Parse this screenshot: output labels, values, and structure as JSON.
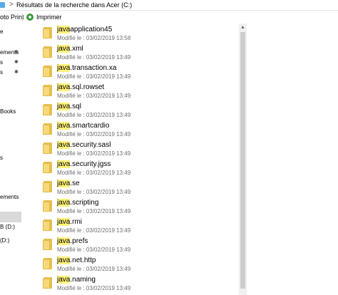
{
  "address": {
    "separator": ">",
    "path": "Résultats de la recherche dans Acer (C:)"
  },
  "toolbar": {
    "left_text": "oto Print",
    "print_label": "Imprimer"
  },
  "nav": {
    "items": [
      {
        "label": "e",
        "pinned": false
      },
      {
        "label": "ements",
        "pinned": true
      },
      {
        "label": "s",
        "pinned": true
      },
      {
        "label": "s",
        "pinned": true
      },
      {
        "label": "Books",
        "pinned": false
      },
      {
        "label": "s",
        "pinned": false
      },
      {
        "label": "ements",
        "pinned": false
      },
      {
        "label": "B (D:)",
        "pinned": false
      },
      {
        "label": "(D:)",
        "pinned": false
      }
    ]
  },
  "results": {
    "modified_label": "Modifié le :",
    "items": [
      {
        "highlight": "java",
        "rest": "application45",
        "date": "03/02/2019 13:58"
      },
      {
        "highlight": "java",
        "rest": ".xml",
        "date": "03/02/2019 13:49"
      },
      {
        "highlight": "java",
        "rest": ".transaction.xa",
        "date": "03/02/2019 13:49"
      },
      {
        "highlight": "java",
        "rest": ".sql.rowset",
        "date": "03/02/2019 13:49"
      },
      {
        "highlight": "java",
        "rest": ".sql",
        "date": "03/02/2019 13:49"
      },
      {
        "highlight": "java",
        "rest": ".smartcardio",
        "date": "03/02/2019 13:49"
      },
      {
        "highlight": "java",
        "rest": ".security.sasl",
        "date": "03/02/2019 13:49"
      },
      {
        "highlight": "java",
        "rest": ".security.jgss",
        "date": "03/02/2019 13:49"
      },
      {
        "highlight": "java",
        "rest": ".se",
        "date": "03/02/2019 13:49"
      },
      {
        "highlight": "java",
        "rest": ".scripting",
        "date": "03/02/2019 13:49"
      },
      {
        "highlight": "java",
        "rest": ".rmi",
        "date": "03/02/2019 13:49"
      },
      {
        "highlight": "java",
        "rest": ".prefs",
        "date": "03/02/2019 13:49"
      },
      {
        "highlight": "java",
        "rest": ".net.http",
        "date": "03/02/2019 13:49"
      },
      {
        "highlight": "java",
        "rest": ".naming",
        "date": "03/02/2019 13:49"
      }
    ]
  }
}
